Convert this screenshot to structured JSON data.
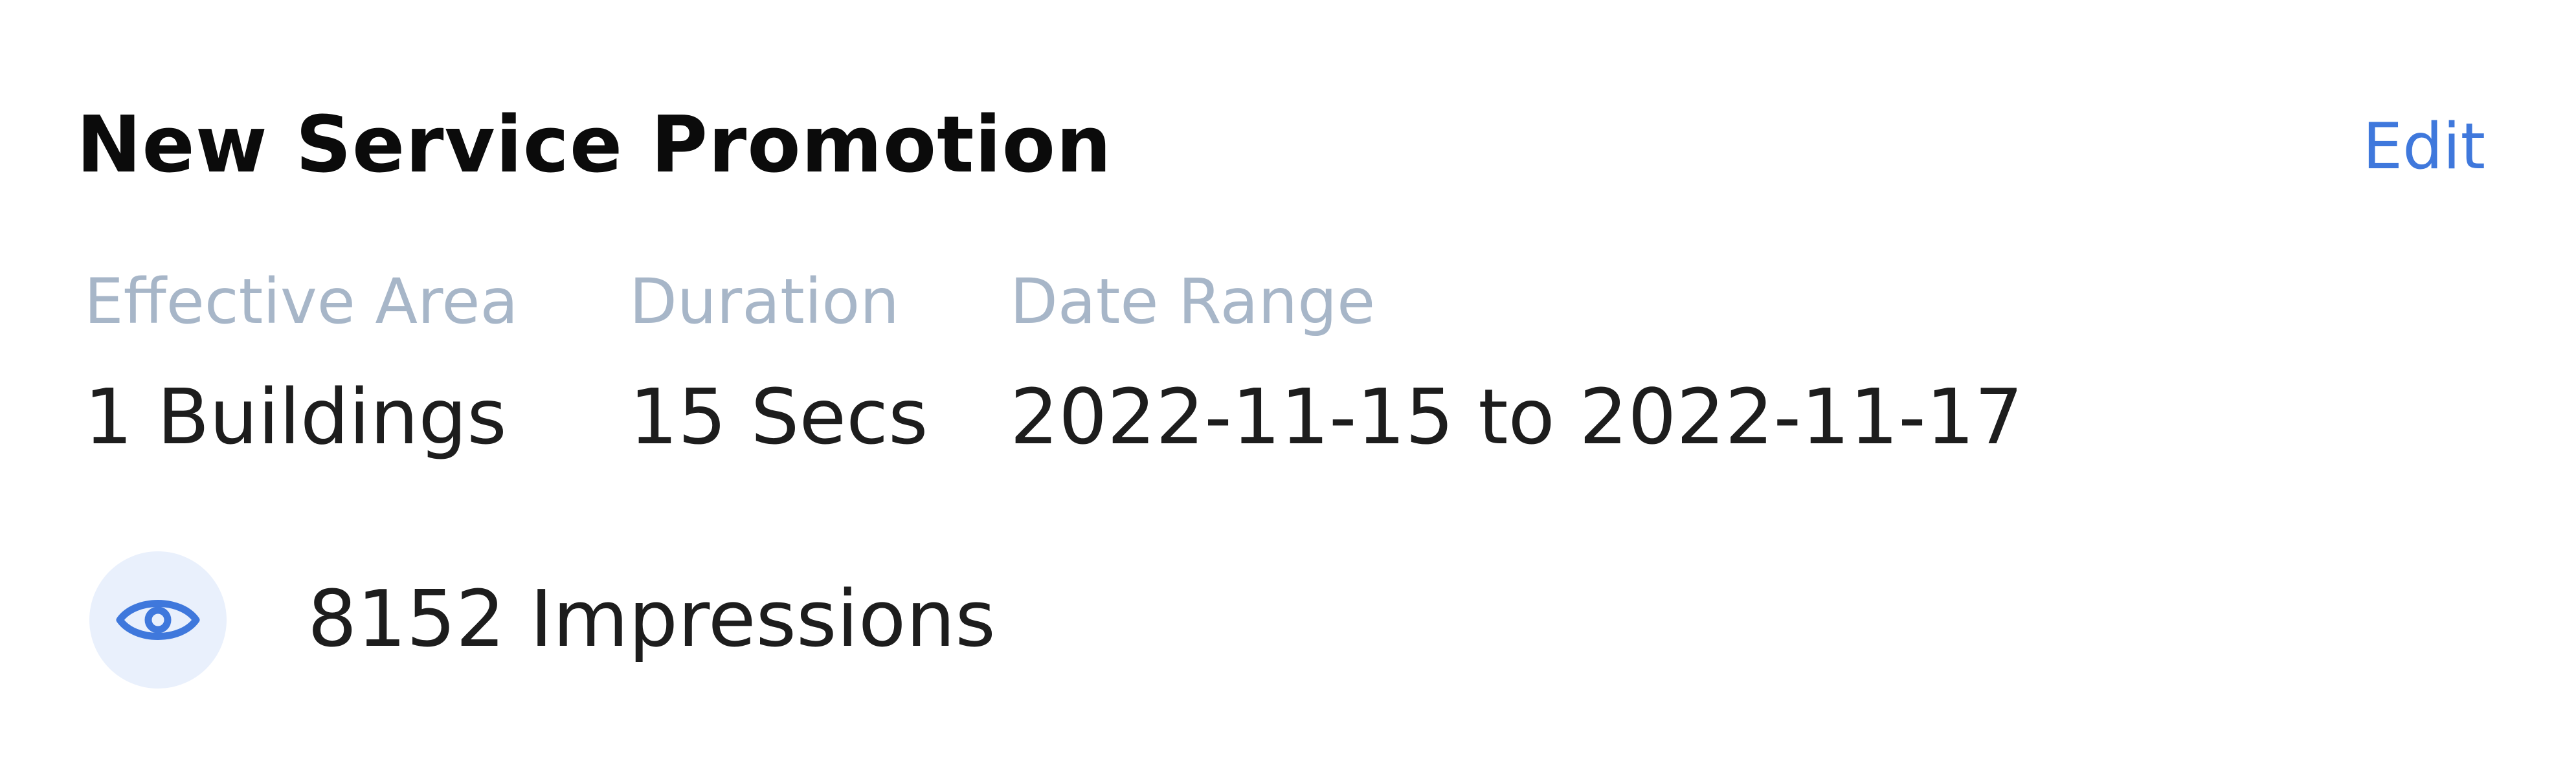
{
  "card": {
    "title": "New Service Promotion",
    "edit_label": "Edit",
    "details": [
      {
        "label": "Effective Area",
        "value": "1 Buildings"
      },
      {
        "label": "Duration",
        "value": "15 Secs"
      },
      {
        "label": "Date Range",
        "value": "2022-11-15 to 2022-11-17"
      }
    ],
    "impressions": {
      "icon": "eye-icon",
      "text": "8152 Impressions"
    }
  },
  "colors": {
    "accent": "#3f78dc",
    "label": "#a7b6c8",
    "title": "#0b0b0b",
    "icon_badge_bg": "#e9f0fc"
  }
}
